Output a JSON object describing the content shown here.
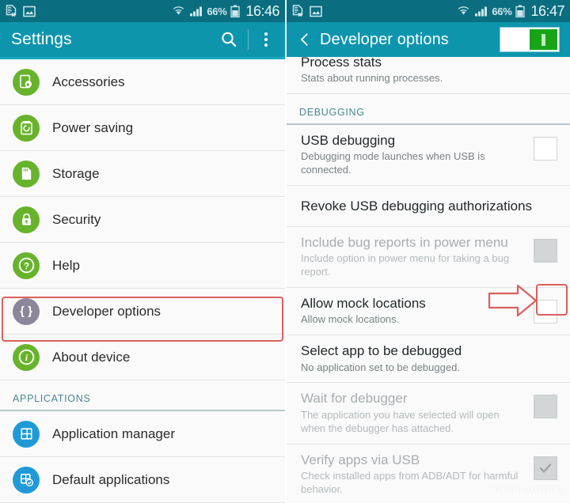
{
  "colors": {
    "status_bar": "#0a6e80",
    "action_bar": "#0d95ad",
    "icon_green": "#67b32c",
    "icon_blue": "#1f9ad6",
    "icon_grape": "#8b8699",
    "annotation_red": "#d9605c",
    "toggle_on_green": "#17a417",
    "section_label": "#4b8794"
  },
  "left": {
    "status": {
      "battery_percent": "66%",
      "time": "16:46",
      "icons": [
        "document-x-icon",
        "picture-icon",
        "wifi-icon",
        "signal-bars-icon",
        "battery-icon"
      ]
    },
    "action_bar": {
      "title": "Settings",
      "search_icon": "search-icon",
      "overflow_icon": "overflow-menu-icon"
    },
    "items": [
      {
        "label": "Accessories",
        "icon": "accessories-icon",
        "icon_color": "green",
        "glyph": "headset"
      },
      {
        "label": "Power saving",
        "icon": "power-saving-icon",
        "icon_color": "green",
        "glyph": "battery"
      },
      {
        "label": "Storage",
        "icon": "storage-icon",
        "icon_color": "green",
        "glyph": "sdcard"
      },
      {
        "label": "Security",
        "icon": "security-icon",
        "icon_color": "green",
        "glyph": "lock"
      },
      {
        "label": "Help",
        "icon": "help-icon",
        "icon_color": "green",
        "glyph": "question"
      },
      {
        "label": "Developer options",
        "icon": "developer-options-icon",
        "icon_color": "grape",
        "glyph": "braces",
        "highlighted": true
      },
      {
        "label": "About device",
        "icon": "about-device-icon",
        "icon_color": "green",
        "glyph": "info"
      }
    ],
    "section": {
      "label": "APPLICATIONS"
    },
    "app_items": [
      {
        "label": "Application manager",
        "icon": "application-manager-icon",
        "icon_color": "blue",
        "glyph": "grid"
      },
      {
        "label": "Default applications",
        "icon": "default-applications-icon",
        "icon_color": "blue",
        "glyph": "grid-check"
      }
    ]
  },
  "right": {
    "status": {
      "battery_percent": "66%",
      "time": "16:47",
      "icons": [
        "document-x-icon",
        "picture-icon",
        "wifi-icon",
        "signal-bars-icon",
        "battery-icon"
      ]
    },
    "action_bar": {
      "title": "Developer options",
      "back_icon": "back-chevron-icon",
      "toggle_state": "on"
    },
    "partial_top": {
      "title": "Process stats",
      "subtitle": "Stats about running processes."
    },
    "section": {
      "label": "DEBUGGING"
    },
    "rows": [
      {
        "title": "USB debugging",
        "subtitle": "Debugging mode launches when USB is connected.",
        "control": "checkbox",
        "state": "unchecked",
        "enabled": true
      },
      {
        "title": "Revoke USB debugging authorizations",
        "subtitle": "",
        "control": "none",
        "state": "",
        "enabled": true
      },
      {
        "title": "Include bug reports in power menu",
        "subtitle": "Include option in power menu for taking a bug report.",
        "control": "checkbox",
        "state": "disabled",
        "enabled": false
      },
      {
        "title": "Allow mock locations",
        "subtitle": "Allow mock locations.",
        "control": "checkbox",
        "state": "unchecked",
        "enabled": true,
        "highlighted": true
      },
      {
        "title": "Select app to be debugged",
        "subtitle": "No application set to be debugged.",
        "control": "none",
        "state": "",
        "enabled": true
      },
      {
        "title": "Wait for debugger",
        "subtitle": "The application you have selected will open when the debugger has attached.",
        "control": "checkbox",
        "state": "disabled",
        "enabled": false
      },
      {
        "title": "Verify apps via USB",
        "subtitle": "Check installed apps from ADB/ADT for harmful behavior.",
        "control": "checkbox",
        "state": "checked-disabled",
        "enabled": false
      }
    ],
    "watermark": "PhoneArena"
  }
}
